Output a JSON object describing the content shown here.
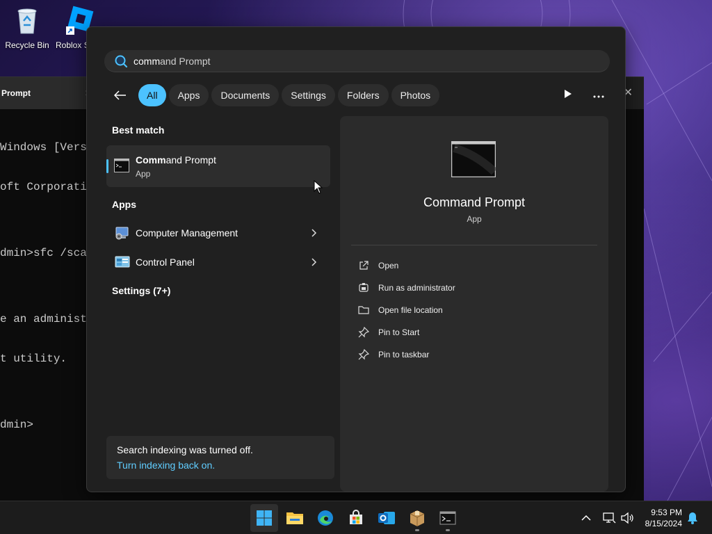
{
  "desktop": {
    "icons": [
      {
        "label": "Recycle Bin",
        "icon": "recycle-bin-icon"
      },
      {
        "label": "Roblox S",
        "icon": "roblox-studio-icon"
      }
    ]
  },
  "cmd_window": {
    "tab_title": "Prompt",
    "lines": [
      "Windows [Versio",
      "oft Corporation",
      "",
      "dmin>sfc /scann",
      "",
      "e an administra",
      "t utility.",
      "",
      "dmin>"
    ]
  },
  "search": {
    "query_typed": "comm",
    "query_completion": "and Prompt"
  },
  "filters": {
    "items": [
      "All",
      "Apps",
      "Documents",
      "Settings",
      "Folders",
      "Photos"
    ],
    "active": "All"
  },
  "results": {
    "best_match_heading": "Best match",
    "best_match": {
      "title_bold": "Comm",
      "title_rest": "and Prompt",
      "subtitle": "App",
      "icon": "command-prompt-icon"
    },
    "apps_heading": "Apps",
    "apps": [
      {
        "label": "Computer Management",
        "icon": "computer-management-icon"
      },
      {
        "label": "Control Panel",
        "icon": "control-panel-icon"
      }
    ],
    "settings_heading": "Settings (7+)"
  },
  "indexing": {
    "message": "Search indexing was turned off.",
    "link": "Turn indexing back on."
  },
  "detail": {
    "name": "Command Prompt",
    "kind": "App",
    "actions": [
      {
        "label": "Open",
        "icon": "open-external-icon"
      },
      {
        "label": "Run as administrator",
        "icon": "shield-admin-icon"
      },
      {
        "label": "Open file location",
        "icon": "folder-icon"
      },
      {
        "label": "Pin to Start",
        "icon": "pin-icon"
      },
      {
        "label": "Pin to taskbar",
        "icon": "pin-icon"
      }
    ]
  },
  "taskbar": {
    "apps": [
      "start-icon",
      "file-explorer-icon",
      "edge-icon",
      "microsoft-store-icon",
      "outlook-icon",
      "package-icon",
      "terminal-icon"
    ],
    "time": "9:53 PM",
    "date": "8/15/2024"
  },
  "colors": {
    "accent": "#4cc2ff",
    "link": "#60cdff",
    "panel": "#202020"
  }
}
